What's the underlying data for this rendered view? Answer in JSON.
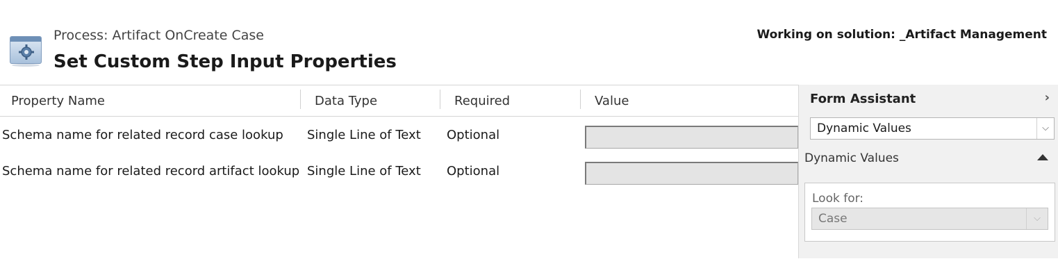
{
  "header": {
    "process_label": "Process: Artifact OnCreate Case",
    "title": "Set Custom Step Input Properties",
    "solution": "Working on solution: _Artifact Management"
  },
  "grid": {
    "columns": [
      "Property Name",
      "Data Type",
      "Required",
      "Value"
    ],
    "rows": [
      {
        "property": "Schema name for related record case lookup",
        "type": "Single Line of Text",
        "required": "Optional",
        "value": ""
      },
      {
        "property": "Schema name for related record artifact lookup",
        "type": "Single Line of Text",
        "required": "Optional",
        "value": ""
      }
    ]
  },
  "assistant": {
    "title": "Form Assistant",
    "chevron": "›",
    "selected": "Dynamic Values",
    "section_label": "Dynamic Values",
    "look_for_label": "Look for:",
    "look_for_value": "Case"
  },
  "icons": {
    "process": "process-gear-icon",
    "expand": "chevron-right-icon",
    "dropdown": "chevron-down-icon",
    "collapse": "triangle-up-icon"
  }
}
